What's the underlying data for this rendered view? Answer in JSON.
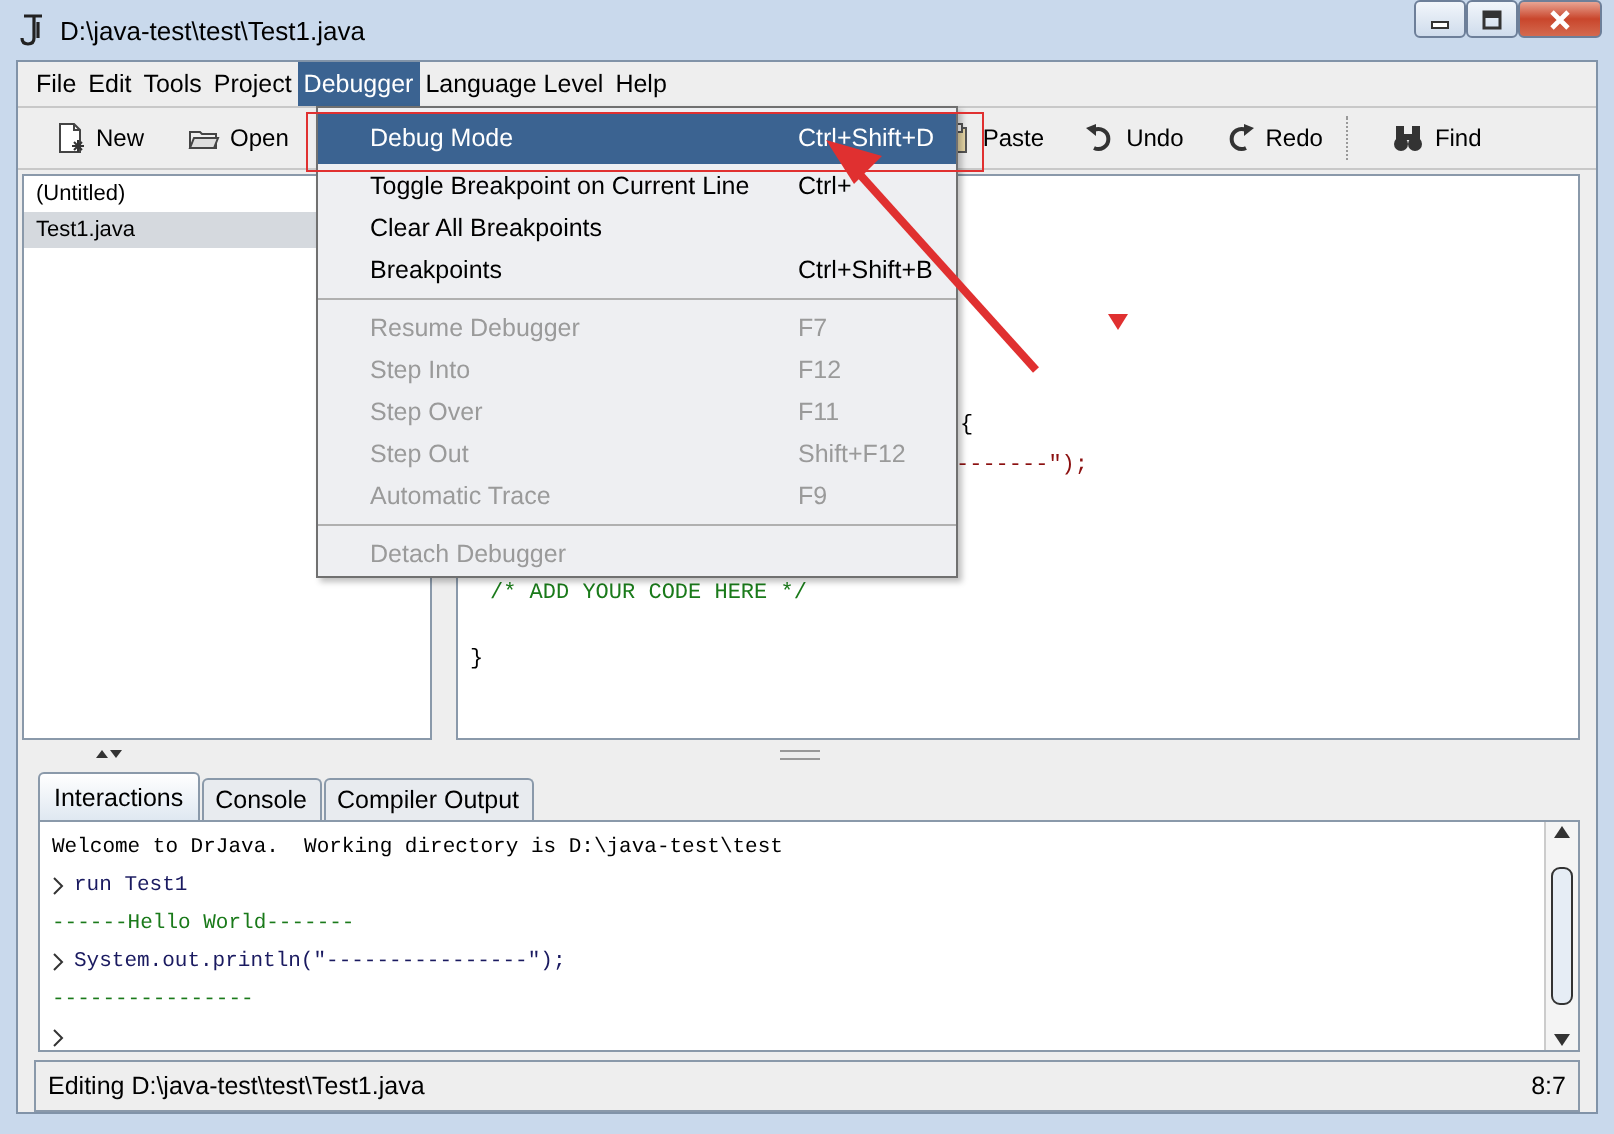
{
  "window": {
    "title": "D:\\java-test\\test\\Test1.java"
  },
  "menubar": [
    {
      "label": "File",
      "selected": false
    },
    {
      "label": "Edit",
      "selected": false
    },
    {
      "label": "Tools",
      "selected": false
    },
    {
      "label": "Project",
      "selected": false
    },
    {
      "label": "Debugger",
      "selected": true
    },
    {
      "label": "Language Level",
      "selected": false
    },
    {
      "label": "Help",
      "selected": false
    }
  ],
  "toolbar": [
    {
      "label": "New",
      "kind": "new"
    },
    {
      "label": "Open",
      "kind": "open"
    },
    {
      "label": "Paste",
      "kind": "paste"
    },
    {
      "label": "Undo",
      "kind": "undo"
    },
    {
      "label": "Redo",
      "kind": "redo"
    },
    {
      "label": "Find",
      "kind": "find"
    }
  ],
  "files": [
    {
      "label": "(Untitled)",
      "selected": false
    },
    {
      "label": "Test1.java",
      "selected": true
    }
  ],
  "editor": {
    "lines": [
      {
        "text": "{",
        "kind": "code"
      },
      {
        "text": "-------\");",
        "kind": "string"
      },
      {
        "text": "/* ADD YOUR CODE HERE */",
        "kind": "comment"
      },
      {
        "text": "}",
        "kind": "code"
      }
    ]
  },
  "debugger_menu": [
    {
      "kind": "item",
      "label": "Debug Mode",
      "shortcut": "Ctrl+Shift+D",
      "disabled": false,
      "selected": true
    },
    {
      "kind": "item",
      "label": "Toggle Breakpoint on Current Line",
      "shortcut": "Ctrl+",
      "disabled": false,
      "selected": false
    },
    {
      "kind": "item",
      "label": "Clear All Breakpoints",
      "disabled": false,
      "selected": false
    },
    {
      "kind": "item",
      "label": "Breakpoints",
      "shortcut": "Ctrl+Shift+B",
      "disabled": false,
      "selected": false
    },
    {
      "kind": "separator"
    },
    {
      "kind": "item",
      "label": "Resume Debugger",
      "shortcut": "F7",
      "disabled": true,
      "selected": false
    },
    {
      "kind": "item",
      "label": "Step Into",
      "shortcut": "F12",
      "disabled": true,
      "selected": false
    },
    {
      "kind": "item",
      "label": "Step Over",
      "shortcut": "F11",
      "disabled": true,
      "selected": false
    },
    {
      "kind": "item",
      "label": "Step Out",
      "shortcut": "Shift+F12",
      "disabled": true,
      "selected": false
    },
    {
      "kind": "item",
      "label": "Automatic Trace",
      "shortcut": "F9",
      "disabled": true,
      "selected": false
    },
    {
      "kind": "separator"
    },
    {
      "kind": "item",
      "label": "Detach Debugger",
      "disabled": true,
      "selected": false
    }
  ],
  "tabs": [
    {
      "label": "Interactions",
      "selected": true
    },
    {
      "label": "Console",
      "selected": false
    },
    {
      "label": "Compiler Output",
      "selected": false
    }
  ],
  "interactions": [
    {
      "kind": "text",
      "text": "Welcome to DrJava.  Working directory is D:\\java-test\\test"
    },
    {
      "kind": "prompt",
      "text": "run Test1"
    },
    {
      "kind": "output",
      "text": "------Hello World-------"
    },
    {
      "kind": "prompt",
      "text": "System.out.println(\"----------------\");"
    },
    {
      "kind": "output",
      "text": "----------------"
    },
    {
      "kind": "prompt"
    }
  ],
  "status_bar": {
    "message": "Editing D:\\java-test\\test\\Test1.java",
    "position": "8:7"
  }
}
